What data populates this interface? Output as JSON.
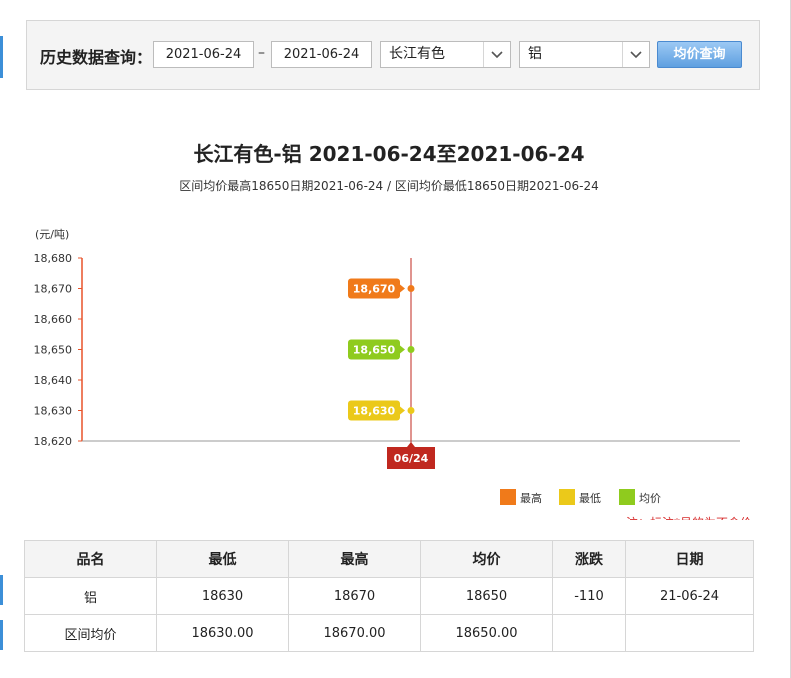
{
  "query": {
    "label": "历史数据查询：",
    "date_from": "2021-06-24",
    "date_to": "2021-06-24",
    "separator": "–",
    "market": "长江有色",
    "metal": "铝",
    "button": "均价查询"
  },
  "header": {
    "title": "长江有色-铝 2021-06-24至2021-06-24",
    "subtitle": "区间均价最高18650日期2021-06-24 / 区间均价最低18650日期2021-06-24"
  },
  "chart_data": {
    "type": "line",
    "unit_label": "(元/吨)",
    "categories": [
      "06/24"
    ],
    "ylim": [
      18620,
      18680
    ],
    "yticks": [
      18620,
      18630,
      18640,
      18650,
      18660,
      18670,
      18680
    ],
    "ytick_labels": [
      "18,620",
      "18,630",
      "18,640",
      "18,650",
      "18,660",
      "18,670",
      "18,680"
    ],
    "series": [
      {
        "name": "最高",
        "values": [
          18670
        ],
        "label": "18,670",
        "color": "#f07a1a"
      },
      {
        "name": "最低",
        "values": [
          18630
        ],
        "label": "18,630",
        "color": "#ebc91a"
      },
      {
        "name": "均价",
        "values": [
          18650
        ],
        "label": "18,650",
        "color": "#8fcb1e"
      }
    ],
    "crosshair_color": "#c0281f",
    "legend_position": "bottom-right",
    "note": "注：标注*号的为不含价"
  },
  "table": {
    "headers": [
      "品名",
      "最低",
      "最高",
      "均价",
      "涨跌",
      "日期"
    ],
    "rows": [
      [
        "铝",
        "18630",
        "18670",
        "18650",
        "-110",
        "21-06-24"
      ],
      [
        "区间均价",
        "18630.00",
        "18670.00",
        "18650.00",
        "",
        ""
      ]
    ]
  }
}
